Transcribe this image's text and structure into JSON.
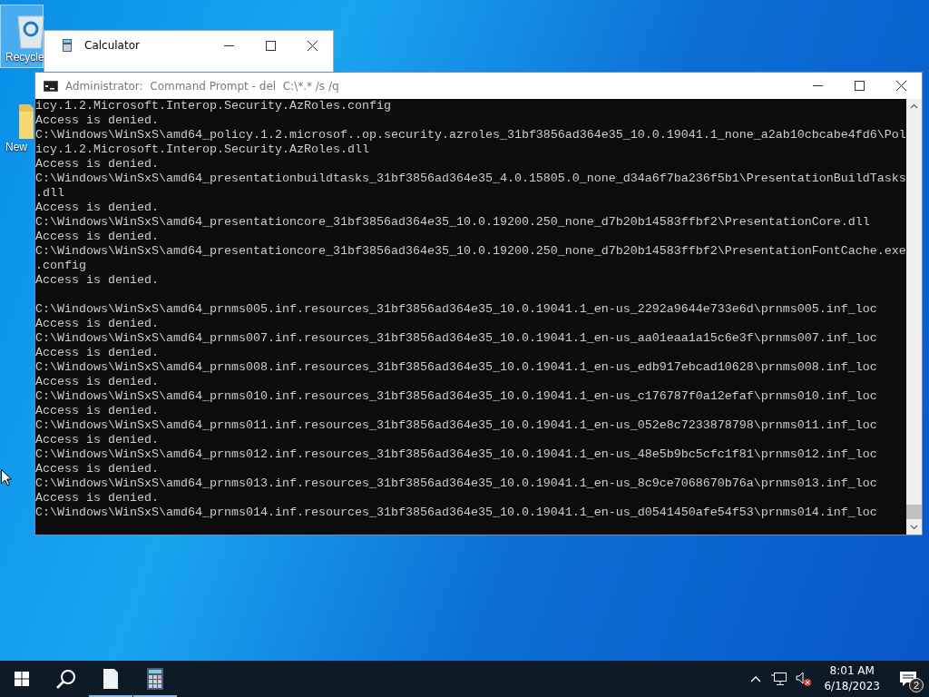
{
  "desktop_icons": [
    {
      "kind": "recycle",
      "label": "Recycle",
      "selected": true
    },
    {
      "kind": "folder",
      "label": "New",
      "selected": false
    }
  ],
  "calculator_window": {
    "title": "Calculator"
  },
  "console_window": {
    "title": "Administrator:  Command Prompt - del  C:\\*.* /s /q",
    "blocks": [
      {
        "lines": [
          "icy.1.2.Microsoft.Interop.Security.AzRoles.config",
          "Access is denied.",
          "C:\\Windows\\WinSxS\\amd64_policy.1.2.microsof..op.security.azroles_31bf3856ad364e35_10.0.19041.1_none_a2ab10cbcabe4fd6\\Pol",
          "icy.1.2.Microsoft.Interop.Security.AzRoles.dll",
          "Access is denied.",
          "C:\\Windows\\WinSxS\\amd64_presentationbuildtasks_31bf3856ad364e35_4.0.15805.0_none_d34a6f7ba236f5b1\\PresentationBuildTasks",
          ".dll",
          "Access is denied.",
          "C:\\Windows\\WinSxS\\amd64_presentationcore_31bf3856ad364e35_10.0.19200.250_none_d7b20b14583ffbf2\\PresentationCore.dll",
          "Access is denied.",
          "C:\\Windows\\WinSxS\\amd64_presentationcore_31bf3856ad364e35_10.0.19200.250_none_d7b20b14583ffbf2\\PresentationFontCache.exe",
          ".config",
          "Access is denied."
        ]
      },
      {
        "lines": [
          "C:\\Windows\\WinSxS\\amd64_prnms005.inf.resources_31bf3856ad364e35_10.0.19041.1_en-us_2292a9644e733e6d\\prnms005.inf_loc",
          "Access is denied.",
          "C:\\Windows\\WinSxS\\amd64_prnms007.inf.resources_31bf3856ad364e35_10.0.19041.1_en-us_aa01eaa1a15c6e3f\\prnms007.inf_loc",
          "Access is denied.",
          "C:\\Windows\\WinSxS\\amd64_prnms008.inf.resources_31bf3856ad364e35_10.0.19041.1_en-us_edb917ebcad10628\\prnms008.inf_loc",
          "Access is denied.",
          "C:\\Windows\\WinSxS\\amd64_prnms010.inf.resources_31bf3856ad364e35_10.0.19041.1_en-us_c176787f0a12efaf\\prnms010.inf_loc",
          "Access is denied.",
          "C:\\Windows\\WinSxS\\amd64_prnms011.inf.resources_31bf3856ad364e35_10.0.19041.1_en-us_052e8c7233878798\\prnms011.inf_loc",
          "Access is denied.",
          "C:\\Windows\\WinSxS\\amd64_prnms012.inf.resources_31bf3856ad364e35_10.0.19041.1_en-us_48e5b9bc5cfc1f81\\prnms012.inf_loc",
          "Access is denied.",
          "C:\\Windows\\WinSxS\\amd64_prnms013.inf.resources_31bf3856ad364e35_10.0.19041.1_en-us_8c9ce7068670b76a\\prnms013.inf_loc",
          "Access is denied.",
          "C:\\Windows\\WinSxS\\amd64_prnms014.inf.resources_31bf3856ad364e35_10.0.19041.1_en-us_d0541450afe54f53\\prnms014.inf_loc"
        ]
      }
    ]
  },
  "taskbar": {
    "items": [
      {
        "kind": "start",
        "running": false
      },
      {
        "kind": "search",
        "running": false
      },
      {
        "kind": "notepad",
        "running": true
      },
      {
        "kind": "calculator",
        "running": true
      }
    ],
    "clock": {
      "time": "8:01 AM",
      "date": "6/18/2023"
    },
    "notifications": {
      "count": "2"
    }
  }
}
